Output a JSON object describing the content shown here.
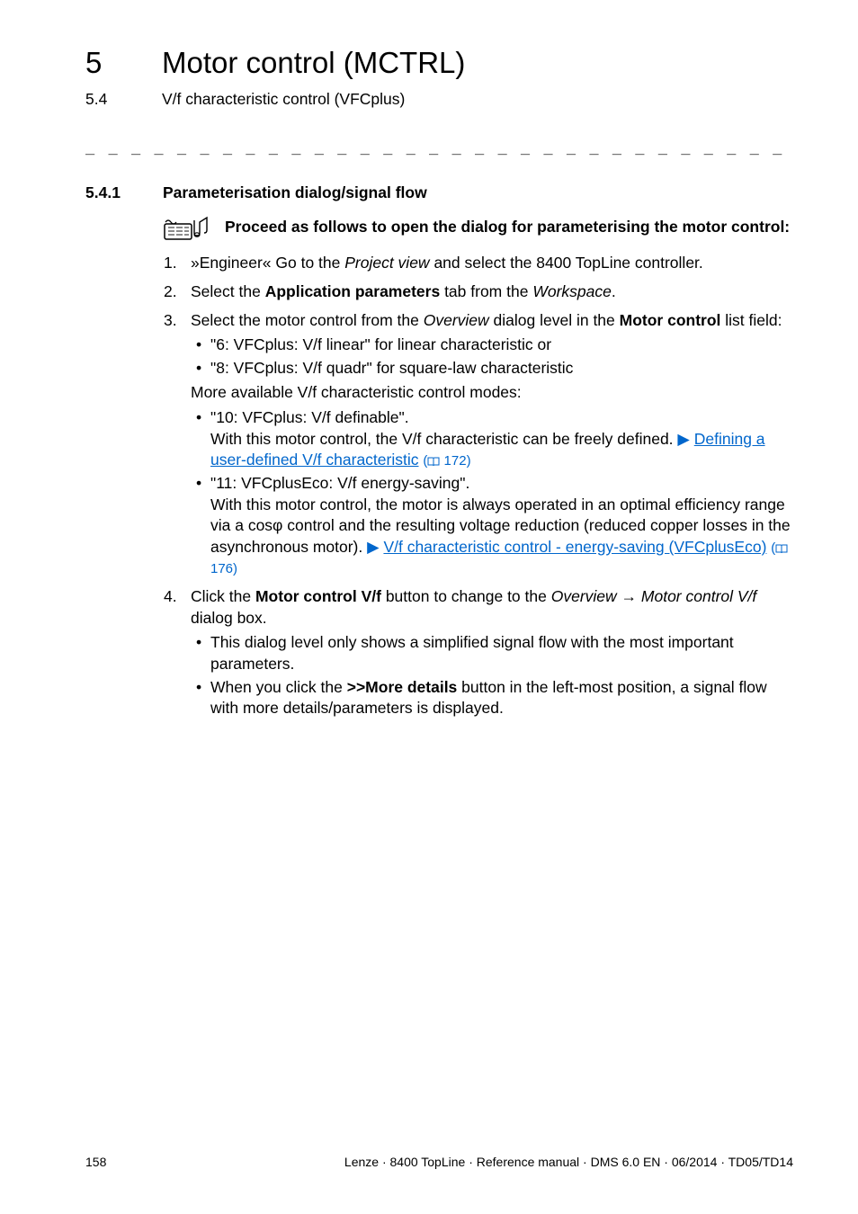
{
  "header": {
    "chapter_num": "5",
    "chapter_title": "Motor control (MCTRL)",
    "sub_num": "5.4",
    "sub_title": "V/f characteristic control (VFCplus)"
  },
  "dashline": "_ _ _ _ _ _ _ _ _ _ _ _ _ _ _ _ _ _ _ _ _ _ _ _ _ _ _ _ _ _ _ _ _ _ _ _ _ _ _ _ _ _ _ _ _ _ _ _ _ _ _ _ _ _ _ _ _ _ _ _ _ _ _ _",
  "section": {
    "num": "5.4.1",
    "title": "Parameterisation dialog/signal flow"
  },
  "lead_text": "Proceed as follows to open the dialog for parameterising the motor control:",
  "steps": [
    {
      "num": "1.",
      "pre": "»Engineer« Go to the ",
      "italic": "Project view",
      "post": " and select the 8400 TopLine controller."
    },
    {
      "num": "2.",
      "pre": "Select the ",
      "bold": "Application parameters",
      "mid": " tab from the ",
      "italic": "Workspace",
      "post": "."
    },
    {
      "num": "3.",
      "pre": "Select the motor control from the ",
      "italic": "Overview",
      "mid": " dialog level in the ",
      "bold": "Motor control",
      "post": " list field:",
      "bullets_a": [
        "\"6: VFCplus: V/f linear\" for linear characteristic or",
        "\"8: VFCplus: V/f quadr\" for square-law characteristic"
      ],
      "note": "More available V/f characteristic control modes:",
      "bullets_b": [
        {
          "label": "\"10: VFCplus: V/f definable\".",
          "text_pre": "With this motor control, the V/f characteristic can be freely defined.  ",
          "link": "Defining a user-defined V/f characteristic",
          "pageref": "172"
        },
        {
          "label": "\"11: VFCplusEco: V/f energy-saving\".",
          "text_pre": "With this motor control, the motor is always operated in an optimal efficiency range via a cosφ control and the resulting voltage reduction (reduced copper losses in the asynchronous motor).  ",
          "link": "V/f characteristic control - energy-saving (VFCplusEco)",
          "pageref": "176"
        }
      ]
    },
    {
      "num": "4.",
      "pre": "Click the ",
      "bold": "Motor control V/f",
      "mid": " button to change to the ",
      "italic_a": "Overview",
      "arrow": " → ",
      "italic_b": "Motor control V/f",
      "post": " dialog box.",
      "bullets": [
        "This dialog level only shows a simplified signal flow with the most important parameters.",
        {
          "pre": "When you click the ",
          "bold": ">>More details",
          "post": " button in the left-most position, a signal flow with more details/parameters is displayed."
        }
      ]
    }
  ],
  "footer": {
    "page": "158",
    "right": "Lenze · 8400 TopLine · Reference manual · DMS 6.0 EN · 06/2014 · TD05/TD14"
  }
}
